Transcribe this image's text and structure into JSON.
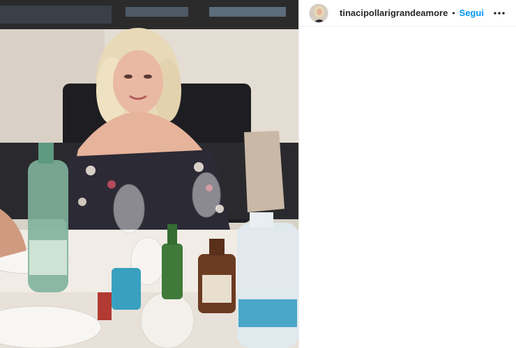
{
  "post": {
    "username": "tinacipollarigrandeamore",
    "separator": "•",
    "follow_label": "Segui",
    "more_icon": "more-horizontal-icon",
    "avatar_icon": "profile-avatar",
    "photo_description_icon": "post-photo"
  },
  "colors": {
    "follow": "#0095f6",
    "username": "#262626",
    "divider": "#efefef"
  }
}
